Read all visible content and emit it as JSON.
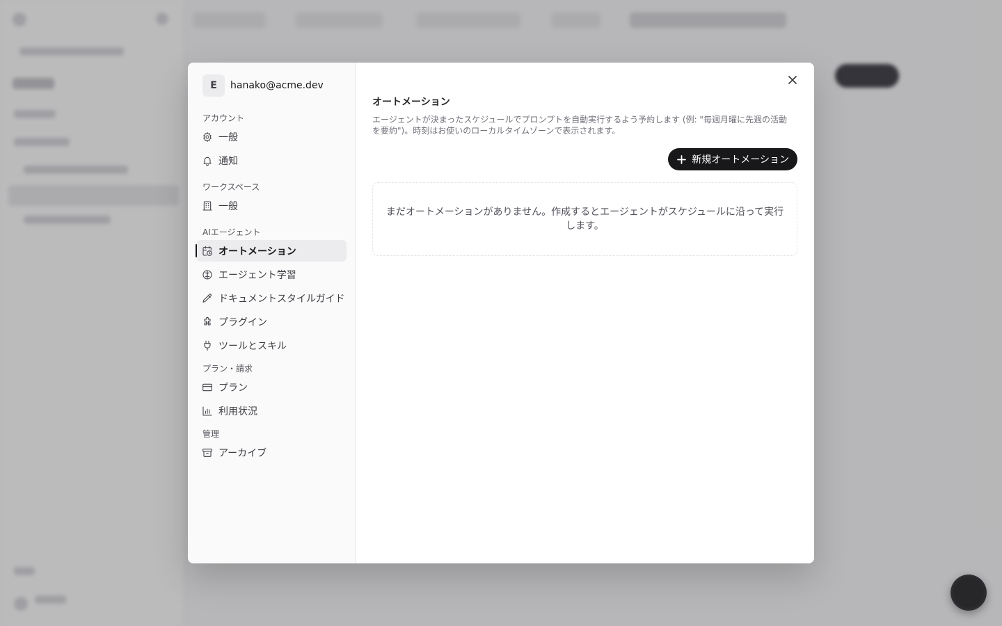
{
  "user": {
    "avatar_letter": "E",
    "email": "hanako@acme.dev"
  },
  "nav": {
    "groups": [
      {
        "label": "アカウント",
        "items": [
          {
            "label": "一般",
            "icon": "gear-icon"
          },
          {
            "label": "通知",
            "icon": "bell-icon"
          }
        ]
      },
      {
        "label": "ワークスペース",
        "items": [
          {
            "label": "一般",
            "icon": "building-icon"
          }
        ]
      },
      {
        "label": "AIエージェント",
        "items": [
          {
            "label": "オートメーション",
            "icon": "calendar-clock-icon",
            "active": true
          },
          {
            "label": "エージェント学習",
            "icon": "brain-icon"
          },
          {
            "label": "ドキュメントスタイルガイド",
            "icon": "pen-icon"
          },
          {
            "label": "プラグイン",
            "icon": "puzzle-icon"
          },
          {
            "label": "ツールとスキル",
            "icon": "plug-icon"
          }
        ]
      },
      {
        "label": "プラン・請求",
        "items": [
          {
            "label": "プラン",
            "icon": "credit-card-icon"
          },
          {
            "label": "利用状況",
            "icon": "bar-chart-icon"
          }
        ]
      },
      {
        "label": "管理",
        "items": [
          {
            "label": "アーカイブ",
            "icon": "archive-icon"
          }
        ]
      }
    ]
  },
  "main": {
    "title": "オートメーション",
    "description": "エージェントが決まったスケジュールでプロンプトを自動実行するよう予約します (例: \"毎週月曜に先週の活動を要約\")。時刻はお使いのローカルタイムゾーンで表示されます。",
    "new_button_label": "新規オートメーション",
    "empty_text": "まだオートメーションがありません。作成するとエージェントがスケジュールに沿って実行します。"
  },
  "colors": {
    "accent": "#18181b",
    "overlay": "#18181b",
    "nav_bg": "#fafafa"
  }
}
